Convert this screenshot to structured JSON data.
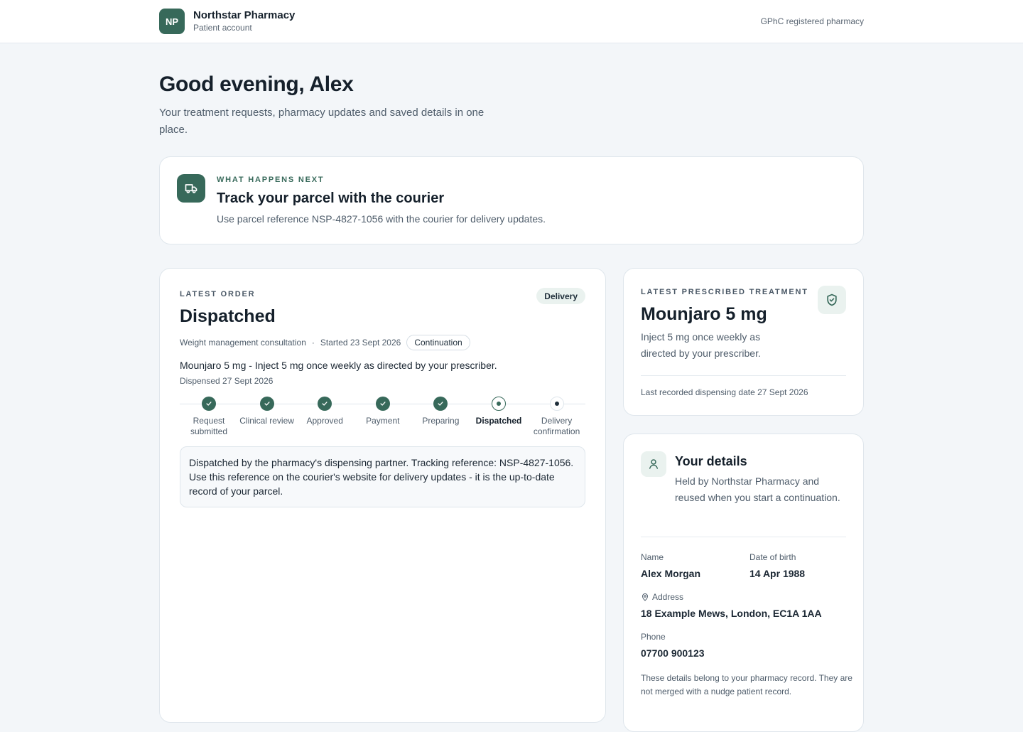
{
  "header": {
    "logo_initials": "NP",
    "brand_name": "Northstar Pharmacy",
    "brand_sub": "Patient account",
    "registration": "GPhC registered pharmacy"
  },
  "greeting": {
    "title": "Good evening, Alex",
    "subtitle": "Your treatment requests, pharmacy updates and saved details in one place."
  },
  "next_step": {
    "icon": "truck-icon",
    "eyebrow": "What happens next",
    "title": "Track your parcel with the courier",
    "text": "Use parcel reference NSP-4827-1056 with the courier for delivery updates."
  },
  "order": {
    "eyebrow": "Latest order",
    "badge": "Delivery",
    "status": "Dispatched",
    "consultation": "Weight management consultation",
    "separator": "·",
    "started": "Started 23 Sept 2026",
    "type_pill": "Continuation",
    "description": "Mounjaro 5 mg - Inject 5 mg once weekly as directed by your prescriber.",
    "dispensed": "Dispensed 27 Sept 2026",
    "steps": [
      {
        "label": "Request submitted",
        "state": "done"
      },
      {
        "label": "Clinical review",
        "state": "done"
      },
      {
        "label": "Approved",
        "state": "done"
      },
      {
        "label": "Payment",
        "state": "done"
      },
      {
        "label": "Preparing",
        "state": "done"
      },
      {
        "label": "Dispatched",
        "state": "current"
      },
      {
        "label": "Delivery confirmation",
        "state": "pending"
      }
    ],
    "note": "Dispatched by the pharmacy's dispensing partner. Tracking reference: NSP-4827-1056. Use this reference on the courier's website for delivery updates - it is the up-to-date record of your parcel."
  },
  "treatment": {
    "eyebrow": "Latest prescribed treatment",
    "icon": "shield-check-icon",
    "name": "Mounjaro 5 mg",
    "instructions": "Inject 5 mg once weekly as directed by your prescriber.",
    "footer": "Last recorded dispensing date 27 Sept 2026"
  },
  "details": {
    "icon": "user-icon",
    "title": "Your details",
    "text": "Held by Northstar Pharmacy and reused when you start a continuation.",
    "name_label": "Name",
    "name_value": "Alex Morgan",
    "dob_label": "Date of birth",
    "dob_value": "14 Apr 1988",
    "address_label": "Address",
    "address_value": "18 Example Mews, London, EC1A 1AA",
    "phone_label": "Phone",
    "phone_value": "07700 900123",
    "footnote": "These details belong to your pharmacy record. They are not merged with a nudge patient record."
  },
  "colors": {
    "brand": "#37695a",
    "background": "#f3f6f9",
    "accent_soft": "#eaf2ef"
  }
}
